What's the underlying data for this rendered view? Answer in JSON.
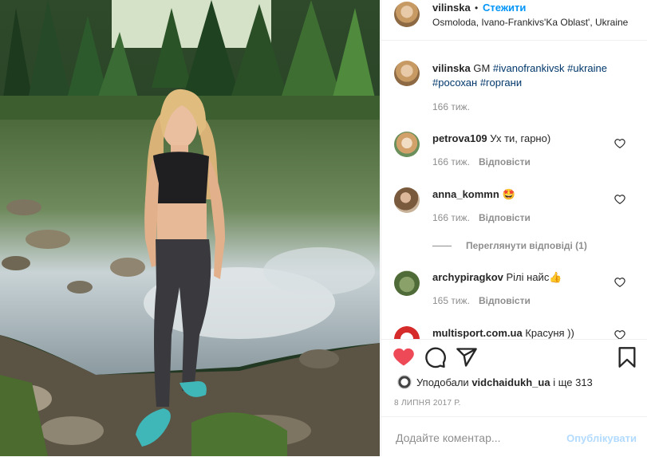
{
  "post": {
    "author": "vilinska",
    "separator": "•",
    "follow_label": "Стежити",
    "location": "Osmoloda, Ivano-Frankivs'Ka Oblast', Ukraine",
    "caption_text": "GM",
    "hashtags": [
      "#ivanofrankivsk",
      "#ukraine",
      "#росохан",
      "#горгани"
    ],
    "caption_time": "166 тиж."
  },
  "comments": [
    {
      "user": "petrova109",
      "text": "Ух ти, гарно)",
      "time": "166 тиж.",
      "reply": "Відповісти"
    },
    {
      "user": "anna_kommn",
      "text": "🤩",
      "time": "166 тиж.",
      "reply": "Відповісти",
      "view_replies": "Переглянути відповіді (1)"
    },
    {
      "user": "archypiragkov",
      "text": "Рілі найс👍",
      "time": "165 тиж.",
      "reply": "Відповісти"
    },
    {
      "user": "multisport.com.ua",
      "text": "Красуня ))"
    }
  ],
  "likes": {
    "prefix": "Уподобали",
    "user": "vidchaidukh_ua",
    "suffix": "і ще 313"
  },
  "date": "8 ЛИПНЯ 2017 Р.",
  "add_comment": {
    "placeholder": "Додайте коментар...",
    "publish_label": "Опублікувати"
  },
  "colors": {
    "like_red": "#ed4956",
    "link_blue": "#0095f6",
    "hashtag": "#00376b",
    "muted": "#8e8e8e"
  },
  "icons": [
    "heart-icon",
    "comment-icon",
    "share-icon",
    "bookmark-icon",
    "like-outline-icon"
  ]
}
